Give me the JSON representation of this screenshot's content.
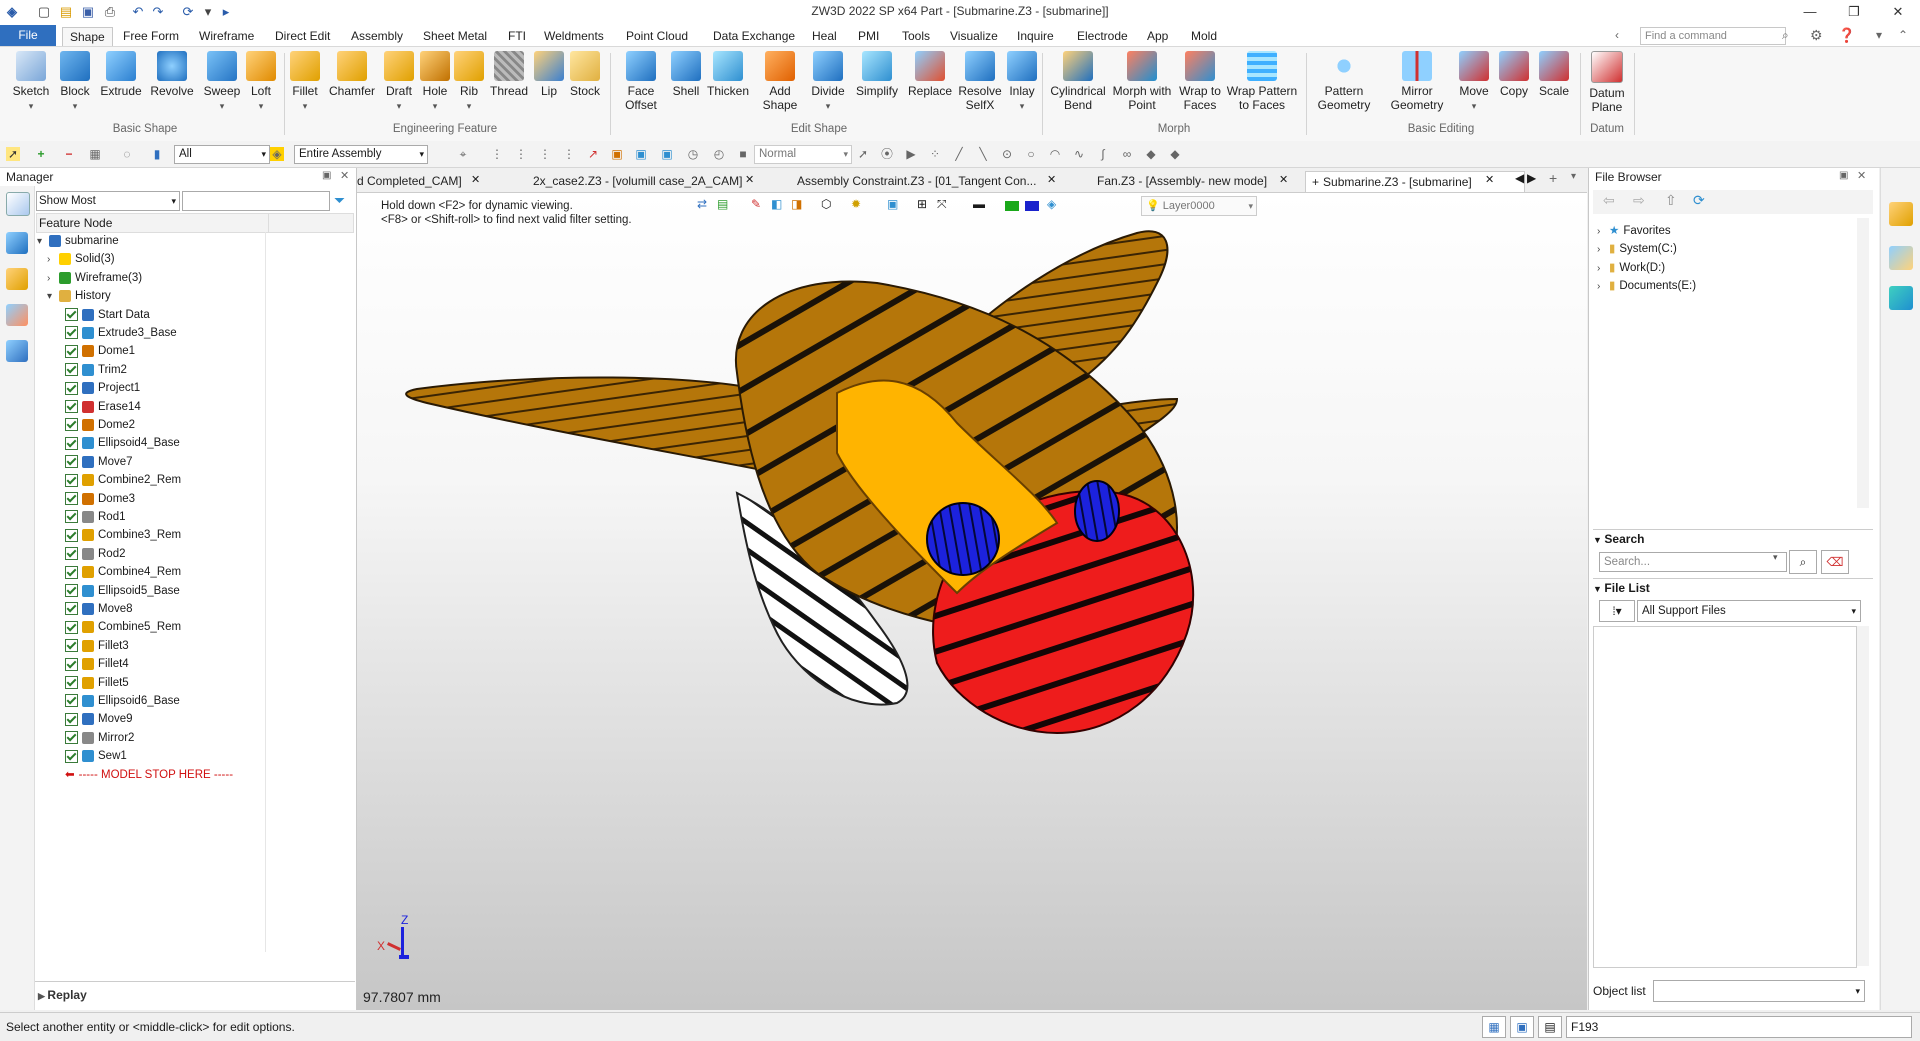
{
  "titlebar": {
    "title": "ZW3D 2022 SP x64          Part - [Submarine.Z3 - [submarine]]",
    "quick_icons": [
      "new-file-icon",
      "open-folder-icon",
      "save-icon",
      "print-icon",
      "undo-icon",
      "redo-icon",
      "regen-icon",
      "customize-icon",
      "run-icon"
    ]
  },
  "menu": {
    "file": "File",
    "tabs": [
      "Shape",
      "Free Form",
      "Wireframe",
      "Direct Edit",
      "Assembly",
      "Sheet Metal",
      "FTI",
      "Weldments",
      "Point Cloud",
      "Data Exchange",
      "Heal",
      "PMI",
      "Tools",
      "Visualize",
      "Inquire",
      "Electrode",
      "App",
      "Mold"
    ],
    "active_tab": "Shape",
    "command_search_placeholder": "Find a command"
  },
  "ribbon": {
    "groups": [
      {
        "label": "Basic Shape",
        "buttons": [
          "Sketch",
          "Block",
          "Extrude",
          "Revolve",
          "Sweep",
          "Loft"
        ]
      },
      {
        "label": "Engineering Feature",
        "buttons": [
          "Fillet",
          "Chamfer",
          "Draft",
          "Hole",
          "Rib",
          "Thread",
          "Lip",
          "Stock"
        ]
      },
      {
        "label": "Edit Shape",
        "buttons": [
          "Face\nOffset",
          "Shell",
          "Thicken",
          "Add\nShape",
          "Divide",
          "Simplify",
          "Replace",
          "Resolve\nSelfX",
          "Inlay"
        ]
      },
      {
        "label": "Morph",
        "buttons": [
          "Cylindrical\nBend",
          "Morph with\nPoint",
          "Wrap to\nFaces",
          "Wrap Pattern\nto Faces"
        ]
      },
      {
        "label": "Basic Editing",
        "buttons": [
          "Pattern\nGeometry",
          "Mirror\nGeometry",
          "Move",
          "Copy",
          "Scale"
        ]
      },
      {
        "label": "Datum",
        "buttons": [
          "Datum\nPlane"
        ]
      }
    ]
  },
  "toolbar2": {
    "filter_value": "All",
    "scope_value": "Entire Assembly",
    "mode_value": "Normal"
  },
  "manager": {
    "title": "Manager",
    "show_filter": "Show Most",
    "column_header": "Feature Node",
    "root": "submarine",
    "groups": [
      "Solid(3)",
      "Wireframe(3)",
      "History"
    ],
    "history": [
      "Start Data",
      "Extrude3_Base",
      "Dome1",
      "Trim2",
      "Project1",
      "Erase14",
      "Dome2",
      "Ellipsoid4_Base",
      "Move7",
      "Combine2_Rem",
      "Dome3",
      "Rod1",
      "Combine3_Rem",
      "Rod2",
      "Combine4_Rem",
      "Ellipsoid5_Base",
      "Move8",
      "Combine5_Rem",
      "Fillet3",
      "Fillet4",
      "Fillet5",
      "Ellipsoid6_Base",
      "Move9",
      "Mirror2",
      "Sew1"
    ],
    "stop_marker": "----- MODEL STOP HERE -----",
    "replay": "Replay"
  },
  "doc_tabs": [
    {
      "label": "d Completed_CAM]"
    },
    {
      "label": "2x_case2.Z3 - [volumill case_2A_CAM]"
    },
    {
      "label": "Assembly Constraint.Z3 - [01_Tangent Con..."
    },
    {
      "label": "Fan.Z3 - [Assembly- new mode]"
    },
    {
      "label": "Submarine.Z3 - [submarine]"
    }
  ],
  "viewport": {
    "hint_line1": "Hold down <F2> for dynamic viewing.",
    "hint_line2": "<F8> or <Shift-roll> to find next valid filter setting.",
    "layer": "Layer0000",
    "measure": "97.7807 mm",
    "axis_x": "X",
    "axis_z": "Z",
    "colors": {
      "body": "#b5760a",
      "shell": "#ffb400",
      "nose": "#ee1c1c",
      "eye": "#1c22dd",
      "fin_white": "#ffffff"
    }
  },
  "file_browser": {
    "title": "File Browser",
    "items": [
      "Favorites",
      "System(C:)",
      "Work(D:)",
      "Documents(E:)"
    ],
    "search_title": "Search",
    "search_placeholder": "Search...",
    "file_list_title": "File List",
    "file_filter": "All Support Files",
    "object_list": "Object list"
  },
  "status": {
    "message": "Select another entity or <middle-click> for edit options.",
    "right_value": "F193"
  }
}
